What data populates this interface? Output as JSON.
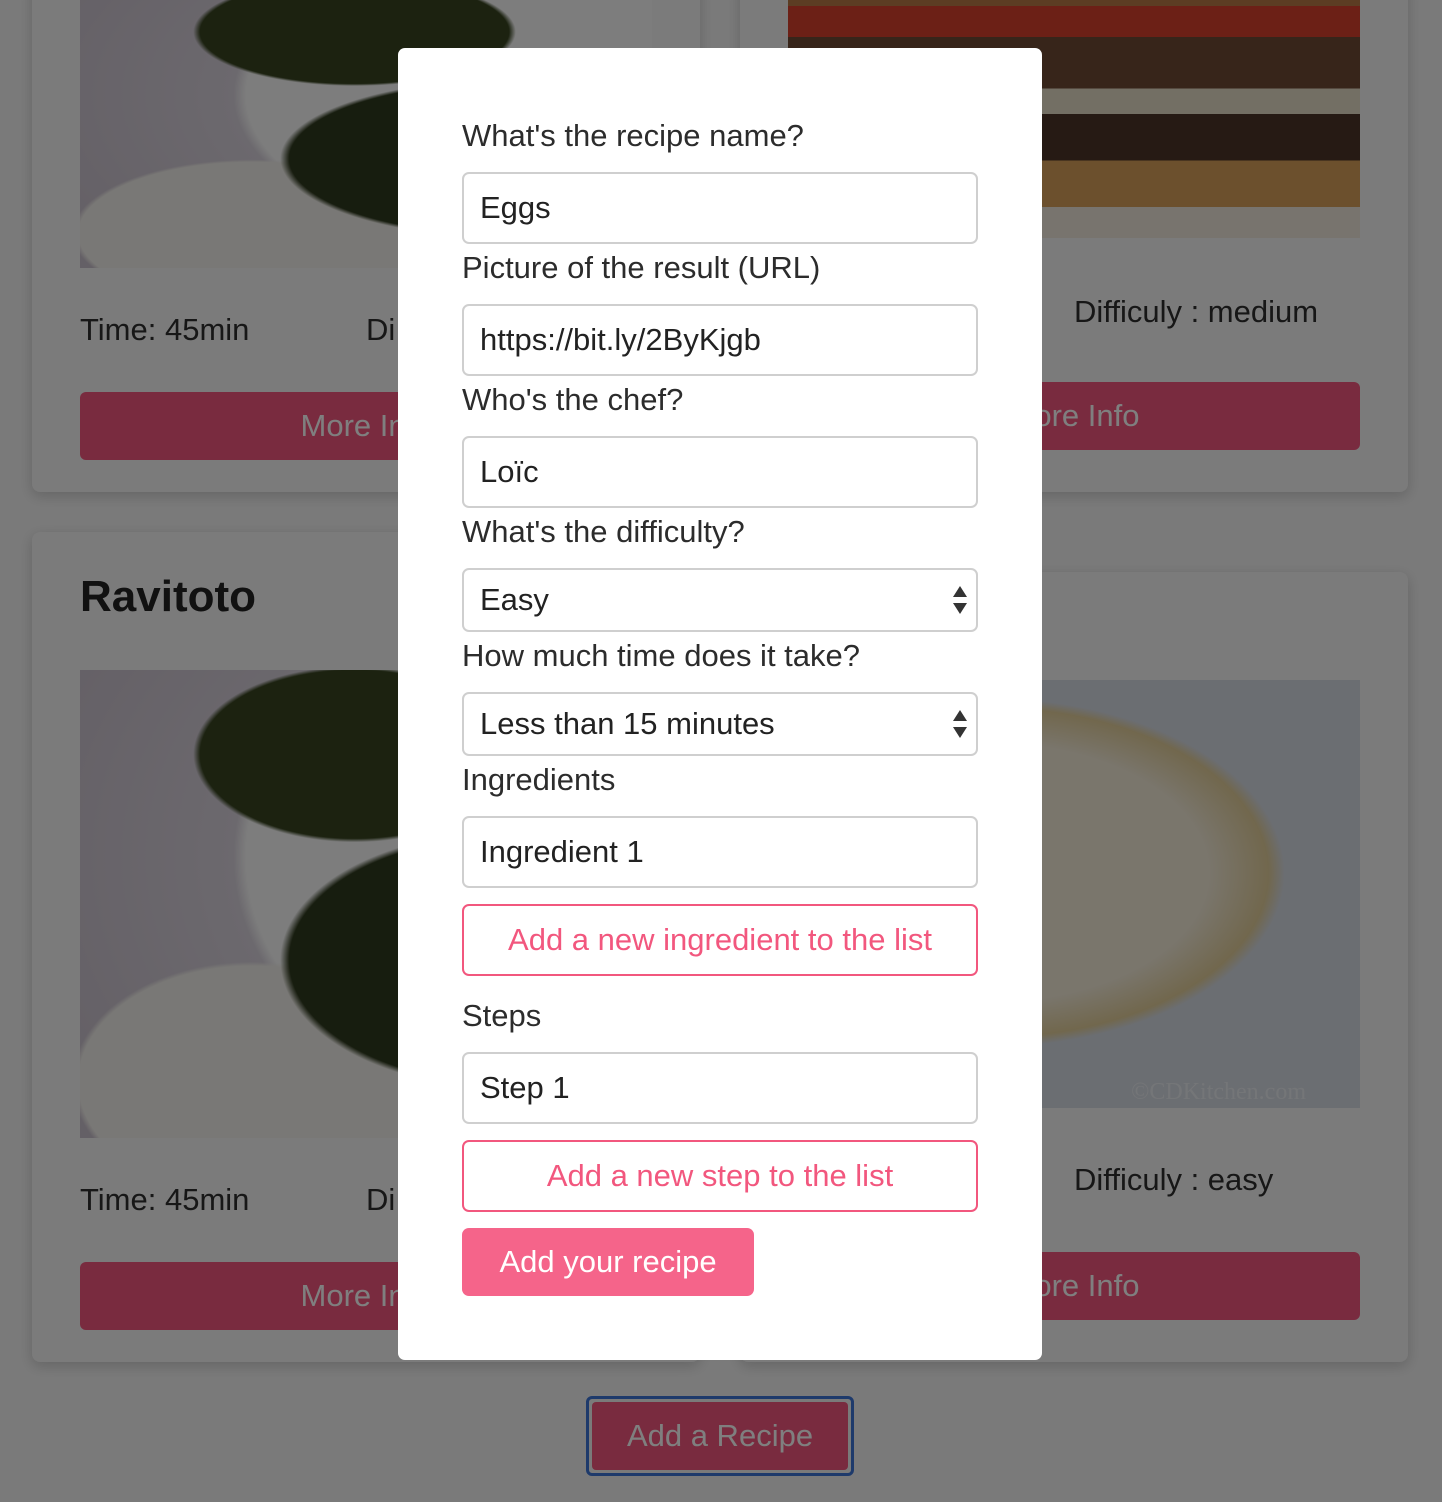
{
  "page": {
    "cards": [
      {
        "title": "",
        "time": "Time: 45min",
        "difficulty": "Di",
        "button": "More Info"
      },
      {
        "title": "",
        "time": "",
        "difficulty": "Difficuly : medium",
        "button": "More Info"
      },
      {
        "title": "Ravitoto",
        "time": "Time: 45min",
        "difficulty": "Di",
        "button": "More Info"
      },
      {
        "title": "",
        "time": "",
        "difficulty": "Difficuly : easy",
        "button": "More Info"
      }
    ],
    "add_recipe_button": "Add a Recipe",
    "image_watermark": "©CDKitchen.com"
  },
  "modal": {
    "name_label": "What's the recipe name?",
    "name_value": "Eggs",
    "picture_label": "Picture of the result (URL)",
    "picture_value": "https://bit.ly/2ByKjgb",
    "chef_label": "Who's the chef?",
    "chef_value": "Loïc",
    "difficulty_label": "What's the difficulty?",
    "difficulty_value": "Easy",
    "time_label": "How much time does it take?",
    "time_value": "Less than 15 minutes",
    "ingredients_label": "Ingredients",
    "ingredient_1_value": "Ingredient 1",
    "add_ingredient_button": "Add a new ingredient to the list",
    "steps_label": "Steps",
    "step_1_value": "Step 1",
    "add_step_button": "Add a new step to the list",
    "submit_button": "Add your recipe"
  },
  "colors": {
    "accent": "#f2577e",
    "focus_ring": "#3c74d6",
    "overlay": "rgba(0,0,0,0.5)"
  }
}
